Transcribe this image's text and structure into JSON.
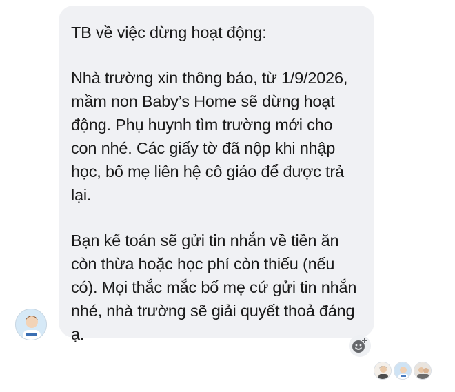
{
  "message": {
    "paragraphs": [
      "TB về việc dừng hoạt động:",
      "Nhà trường xin thông báo, từ 1/9/2026, mầm non Baby’s Home sẽ dừng hoạt động. Phụ huynh tìm trường mới cho con nhé. Các giấy tờ đã nộp khi nhập học, bố mẹ liên hệ cô giáo để được trả lại.",
      "Bạn kế toán sẽ gửi tin nhắn về tiền ăn còn thừa hoặc học phí còn thiếu (nếu có). Mọi thắc mắc bố mẹ cứ gửi tin nhắn nhé, nhà trường sẽ giải quyết thoả đáng ạ."
    ]
  },
  "icons": {
    "sender_avatar": "avatar",
    "reaction": "add-reaction-icon",
    "seen": [
      "seen-avatar",
      "seen-avatar",
      "seen-avatar"
    ]
  },
  "colors": {
    "bubble": "#f0f1f4",
    "text": "#1a1a1a",
    "reaction_icon": "#65676b"
  }
}
